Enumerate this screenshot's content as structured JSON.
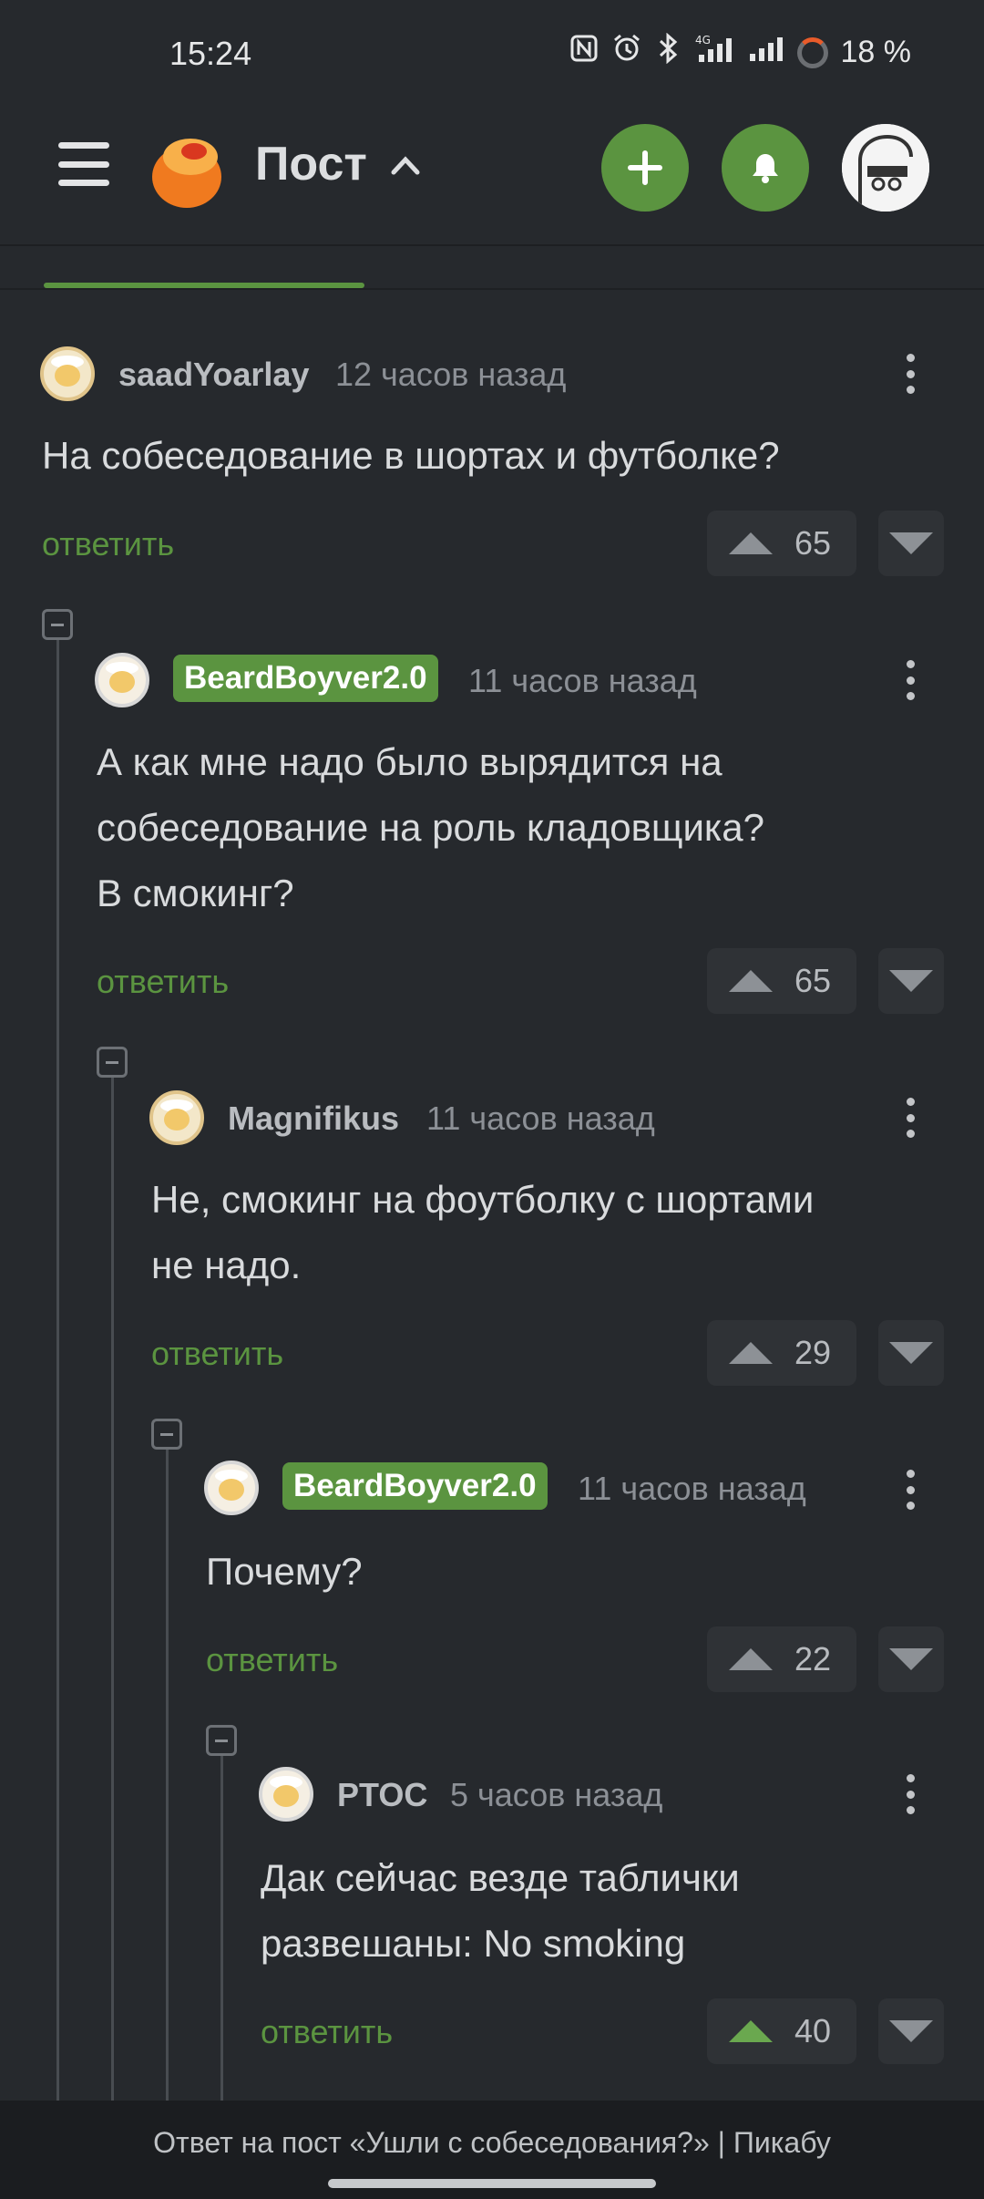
{
  "status_bar": {
    "time": "15:24",
    "icons": [
      "nfc-icon",
      "alarm-icon",
      "bluetooth-icon",
      "signal-4g-icon",
      "signal-icon",
      "battery-icon"
    ],
    "battery": "18 %"
  },
  "header": {
    "title": "Пост",
    "colors": {
      "accent": "#5b9440",
      "background": "#26292d"
    }
  },
  "comments": [
    {
      "author": "saadYoarlay",
      "ago": "12 часов назад",
      "text": "На собеседование в шортах и футболке?",
      "reply": "ответить",
      "votes": "65",
      "badge": false
    },
    {
      "author": "BeardBoyver2.0",
      "ago": "11 часов назад",
      "text_lines": [
        "А как мне надо было вырядится на",
        "собеседование на роль кладовщика?",
        "В смокинг?"
      ],
      "reply": "ответить",
      "votes": "65",
      "badge": true
    },
    {
      "author": "Magnifikus",
      "ago": "11 часов назад",
      "text_lines": [
        "Не, смокинг на фоутболку с шортами",
        "не надо."
      ],
      "reply": "ответить",
      "votes": "29",
      "badge": false
    },
    {
      "author": "BeardBoyver2.0",
      "ago": "11 часов назад",
      "text": "Почему?",
      "reply": "ответить",
      "votes": "22",
      "badge": true
    },
    {
      "author": "PTOC",
      "ago": "5 часов назад",
      "text_lines": [
        "Дак сейчас везде таблички",
        "развешаны: No smoking"
      ],
      "reply": "ответить",
      "votes": "40",
      "badge": false,
      "upvoted": true
    }
  ],
  "footer": {
    "caption": "Ответ на пост «Ушли с собеседования?» | Пикабу"
  }
}
